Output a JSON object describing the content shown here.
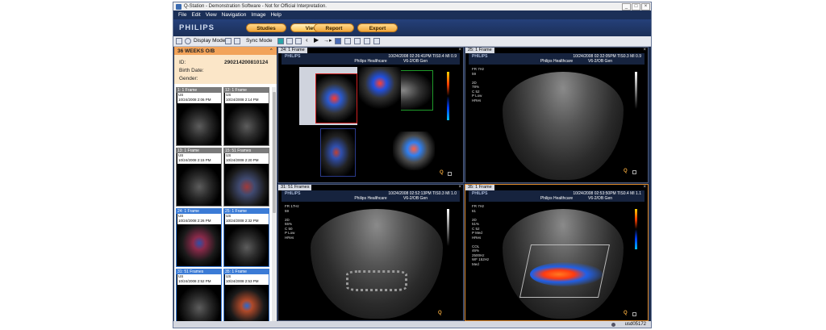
{
  "window": {
    "title": "Q-Station - Demonstration Software - Not for Official Interpretation."
  },
  "menu": [
    "File",
    "Edit",
    "View",
    "Navigation",
    "Image",
    "Help"
  ],
  "brand": "PHILIPS",
  "tabs": [
    {
      "label": "Studies"
    },
    {
      "label": "View"
    },
    {
      "label": "Report"
    },
    {
      "label": "Export"
    }
  ],
  "toolbar": {
    "display_mode": "Display Mode",
    "sync_mode": "Sync Mode"
  },
  "patient": {
    "name": "36 WEEKS O/B",
    "id_label": "ID:",
    "id_value": "290214200810124",
    "birth_label": "Birth Date:",
    "gender_label": "Gender:"
  },
  "thumbnails": [
    {
      "title": "1: 1 Frame",
      "mod": "US",
      "date": "10/24/2008 2:06 PM",
      "selected": false
    },
    {
      "title": "12: 1 Frame",
      "mod": "US",
      "date": "10/24/2008 2:14 PM",
      "selected": false
    },
    {
      "title": "13: 1 Frame",
      "mod": "US",
      "date": "10/24/2008 2:15 PM",
      "selected": false
    },
    {
      "title": "15: 51 Frames",
      "mod": "US",
      "date": "10/24/2008 2:20 PM",
      "selected": false
    },
    {
      "title": "24: 1 Frame",
      "mod": "US",
      "date": "10/24/2008 2:26 PM",
      "selected": true
    },
    {
      "title": "25: 1 Frame",
      "mod": "US",
      "date": "10/24/2008 2:32 PM",
      "selected": true
    },
    {
      "title": "31: 51 Frames",
      "mod": "US",
      "date": "10/24/2008 2:52 PM",
      "selected": true
    },
    {
      "title": "35: 1 Frame",
      "mod": "US",
      "date": "10/24/2008 2:53 PM",
      "selected": true
    }
  ],
  "viewports": [
    {
      "tab": "24: 1 Frame",
      "brand": "PHILIPS",
      "org": "Philips Healthcare",
      "meta": "10/24/2008 02:26:41PM TIS0.4 MI 0.9",
      "probe": "V6-2/OB Gen",
      "side": ""
    },
    {
      "tab": "25: 1 Frame",
      "brand": "PHILIPS",
      "org": "Philips Healthcare",
      "meta": "10/24/2008 02:32:05PM TIS0.3 MI 0.9",
      "probe": "V6-2/OB Gen",
      "side": "FR 7Hz\n59\n\n2D\n78%\nC 52\nP Low\nHRes"
    },
    {
      "tab": "31: 51 Frames",
      "brand": "PHILIPS",
      "org": "Philips Healthcare",
      "meta": "10/24/2008 02:52:13PM TIS0.3 MI 1.0",
      "probe": "V6-2/OB Gen",
      "side": "FR 17Hz\n59\n\n2D\n55%\nC 50\nP Low\nHRes"
    },
    {
      "tab": "35: 1 Frame",
      "brand": "PHILIPS",
      "org": "Philips Healthcare",
      "meta": "10/24/2008 02:53:50PM TIS0.4 MI 1.1",
      "probe": "V6-2/OB Gen",
      "side": "FR 7Hz\n61\n\n2D\n51%\nC 52\nP Med\nHRes\n\nCOL\n46%\n2500Hz\nWF 152Hz\nMed"
    }
  ],
  "status": {
    "user": "usd05172"
  }
}
